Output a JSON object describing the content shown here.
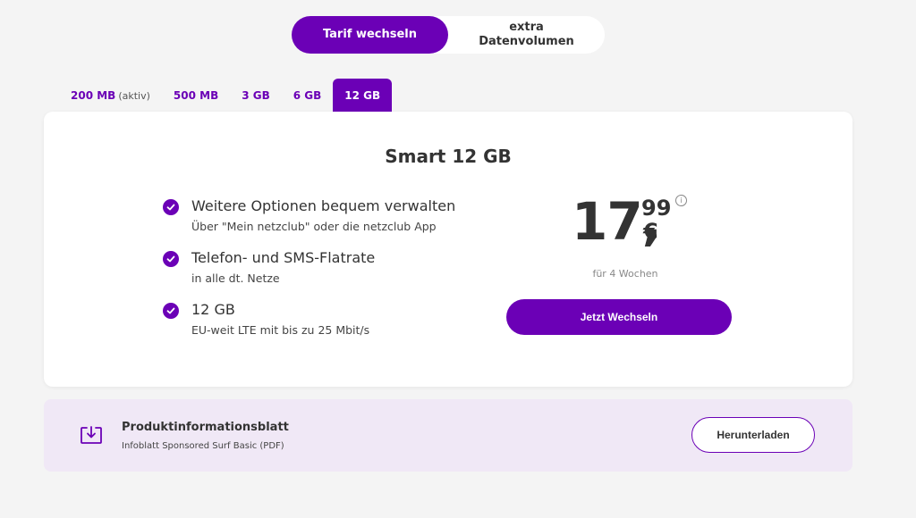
{
  "toggle": {
    "active_label": "Tarif wechseln",
    "inactive_label": "extra\nDatenvolumen"
  },
  "tabs": [
    {
      "label": "200 MB",
      "sub": "(aktiv)"
    },
    {
      "label": "500 MB"
    },
    {
      "label": "3 GB"
    },
    {
      "label": "6 GB"
    },
    {
      "label": "12 GB",
      "active": true
    }
  ],
  "card": {
    "title": "Smart 12 GB",
    "features": [
      {
        "title": "Weitere Optionen bequem verwalten",
        "sub": "Über \"Mein netzclub\" oder die netzclub App"
      },
      {
        "title": "Telefon- und SMS-Flatrate",
        "sub": "in alle dt. Netze"
      },
      {
        "title": "12 GB",
        "sub": "EU-weit LTE mit bis zu 25 Mbit/s"
      }
    ],
    "price": {
      "integer": "17,",
      "decimal": "99",
      "currency": "€"
    },
    "info_symbol": "i",
    "period": "für 4 Wochen",
    "cta_label": "Jetzt Wechseln"
  },
  "download": {
    "title": "Produktinformationsblatt",
    "subtitle": "Infoblatt Sponsored Surf Basic (PDF)",
    "button_label": "Herunterladen"
  },
  "colors": {
    "accent": "#6b00b6",
    "download_bg": "#f0e8f6"
  }
}
